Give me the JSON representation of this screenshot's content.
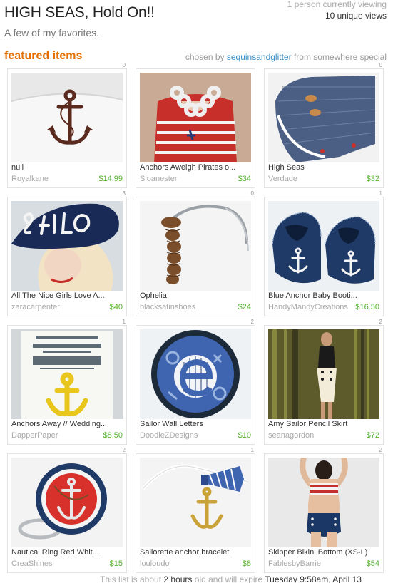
{
  "header": {
    "title": "HIGH SEAS, Hold On!!",
    "subtitle": "A few of my favorites.",
    "viewing": "1 person currently viewing",
    "views": "10 unique views"
  },
  "featured": {
    "label": "featured items",
    "chosen_by": "chosen by",
    "curator": "sequinsandglitter",
    "from": "from",
    "location": "somewhere special"
  },
  "items": [
    {
      "title": "null",
      "shop": "Royalkane",
      "price": "$14.99",
      "badge": "0",
      "icon": "anchor-pillow"
    },
    {
      "title": "Anchors Aweigh Pirates o...",
      "shop": "Sloanester",
      "price": "$34",
      "badge": "",
      "icon": "rope-necklace"
    },
    {
      "title": "High Seas",
      "shop": "Verdade",
      "price": "$32",
      "badge": "0",
      "icon": "denim-cuff"
    },
    {
      "title": "All The Nice Girls Love A...",
      "shop": "zaracarpenter",
      "price": "$40",
      "badge": "3",
      "icon": "sailor-hat"
    },
    {
      "title": "Ophelia",
      "shop": "blacksatinshoes",
      "price": "$24",
      "badge": "0",
      "icon": "rope-headband"
    },
    {
      "title": "Blue Anchor Baby Booti...",
      "shop": "HandyMandyCreations",
      "price": "$16.50",
      "badge": "1",
      "icon": "baby-booties"
    },
    {
      "title": "Anchors Away // Wedding...",
      "shop": "DapperPaper",
      "price": "$8.50",
      "badge": "1",
      "icon": "wedding-invite"
    },
    {
      "title": "Sailor Wall Letters",
      "shop": "DoodleZDesigns",
      "price": "$10",
      "badge": "2",
      "icon": "wall-letter"
    },
    {
      "title": "Amy Sailor Pencil Skirt",
      "shop": "seanagordon",
      "price": "$72",
      "badge": "2",
      "icon": "pencil-skirt"
    },
    {
      "title": "Nautical Ring Red Whit...",
      "shop": "CreaShines",
      "price": "$15",
      "badge": "2",
      "icon": "anchor-ring"
    },
    {
      "title": "Sailorette anchor bracelet",
      "shop": "louloudo",
      "price": "$8",
      "badge": "1",
      "icon": "anchor-bracelet"
    },
    {
      "title": "Skipper Bikini Bottom (XS-L)",
      "shop": "FablesbyBarrie",
      "price": "$54",
      "badge": "2",
      "icon": "bikini"
    }
  ],
  "footer": {
    "prefix": "This list is about",
    "age": "2 hours",
    "middle": "old and will expire",
    "expires": "Tuesday 9:58am, April 13"
  }
}
